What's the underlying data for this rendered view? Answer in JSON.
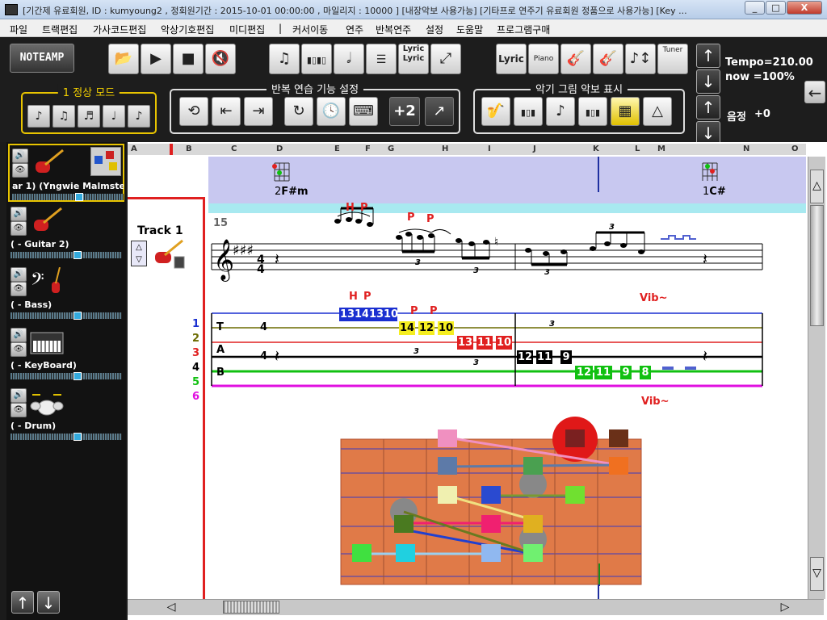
{
  "window": {
    "title": "[기간제 유료회원, ID : kumyoung2 , 정회원기간 : 2015-10-01 00:00:00 , 마일리지 : 10000 ] [내장악보 사용가능] [기타프로 연주기 유료회원 정품으로 사용가능] [Key ...",
    "buttons": {
      "minimize": "_",
      "maximize": "□",
      "close": "X"
    }
  },
  "menu": [
    "파일",
    "트랙편집",
    "가사코드편집",
    "악상기호편집",
    "미디편집",
    "|",
    "커서이동",
    "연주",
    "반복연주",
    "설정",
    "도움말",
    "프로그램구매"
  ],
  "toolbar": {
    "logo": "NOTEAMP",
    "lyric_label": "Lyric",
    "lyric_sub": "Lyric",
    "lyric_btn": "Lyric",
    "piano_btn": "Piano",
    "tuner_btn": "Tuner",
    "mode_group": "1 정상 모드",
    "repeat_group": "반복 연습 기능 설정",
    "score_group": "악기 그림 악보 표시",
    "plus2": "+2",
    "tempo": "Tempo=210.00",
    "now": "now =100%",
    "pitch_label": "음정",
    "pitch_value": "+0"
  },
  "tracks": [
    {
      "name": "ar 1) (Yngwie Malmstee",
      "instrument": "electric-guitar-icon",
      "selected": true
    },
    {
      "name": "( - Guitar 2)",
      "instrument": "electric-guitar-icon",
      "selected": false
    },
    {
      "name": "( - Bass)",
      "instrument": "bass-clef-icon",
      "selected": false
    },
    {
      "name": "( - KeyBoard)",
      "instrument": "keyboard-icon",
      "selected": false
    },
    {
      "name": "( - Drum)",
      "instrument": "drum-kit-icon",
      "selected": false
    }
  ],
  "score": {
    "ruler": [
      "A",
      "B",
      "C",
      "D",
      "E",
      "F",
      "G",
      "H",
      "I",
      "J",
      "K",
      "L",
      "M",
      "N",
      "O"
    ],
    "track_label": "Track 1",
    "measure_number": "15",
    "chords": [
      {
        "label": "2F#m",
        "num": "2",
        "name": "F#m"
      },
      {
        "label": "1C#",
        "num": "1",
        "name": "C#"
      }
    ],
    "techniques": {
      "h": "H",
      "p": "P",
      "vib": "Vib~",
      "triplet": "3"
    },
    "string_numbers": [
      "1",
      "2",
      "3",
      "4",
      "5",
      "6"
    ],
    "string_colors": [
      "#1a2fd0",
      "#6b6b00",
      "#e02020",
      "#000000",
      "#10c010",
      "#e010e0"
    ],
    "tab_letters": [
      "T",
      "A",
      "B"
    ],
    "time_sig": "4",
    "tab_notes": [
      {
        "fret": "13",
        "string": 1,
        "bg": "#1a2fd0",
        "fg": "#fff"
      },
      {
        "fret": "14",
        "string": 1,
        "bg": "#1a2fd0",
        "fg": "#fff"
      },
      {
        "fret": "13",
        "string": 1,
        "bg": "#1a2fd0",
        "fg": "#fff"
      },
      {
        "fret": "10",
        "string": 1,
        "bg": "#1a2fd0",
        "fg": "#fff"
      },
      {
        "fret": "14",
        "string": 2,
        "bg": "#f5ee20",
        "fg": "#000"
      },
      {
        "fret": "12",
        "string": 2,
        "bg": "#f5ee20",
        "fg": "#000"
      },
      {
        "fret": "10",
        "string": 2,
        "bg": "#f5ee20",
        "fg": "#000"
      },
      {
        "fret": "13",
        "string": 3,
        "bg": "#e02020",
        "fg": "#fff"
      },
      {
        "fret": "11",
        "string": 3,
        "bg": "#e02020",
        "fg": "#fff"
      },
      {
        "fret": "10",
        "string": 3,
        "bg": "#e02020",
        "fg": "#fff"
      },
      {
        "fret": "12",
        "string": 4,
        "bg": "#000",
        "fg": "#fff"
      },
      {
        "fret": "11",
        "string": 4,
        "bg": "#000",
        "fg": "#fff"
      },
      {
        "fret": "9",
        "string": 4,
        "bg": "#000",
        "fg": "#fff"
      },
      {
        "fret": "12",
        "string": 5,
        "bg": "#10c010",
        "fg": "#fff"
      },
      {
        "fret": "11",
        "string": 5,
        "bg": "#10c010",
        "fg": "#fff"
      },
      {
        "fret": "9",
        "string": 5,
        "bg": "#10c010",
        "fg": "#fff"
      },
      {
        "fret": "8",
        "string": 5,
        "bg": "#10c010",
        "fg": "#fff"
      }
    ]
  }
}
